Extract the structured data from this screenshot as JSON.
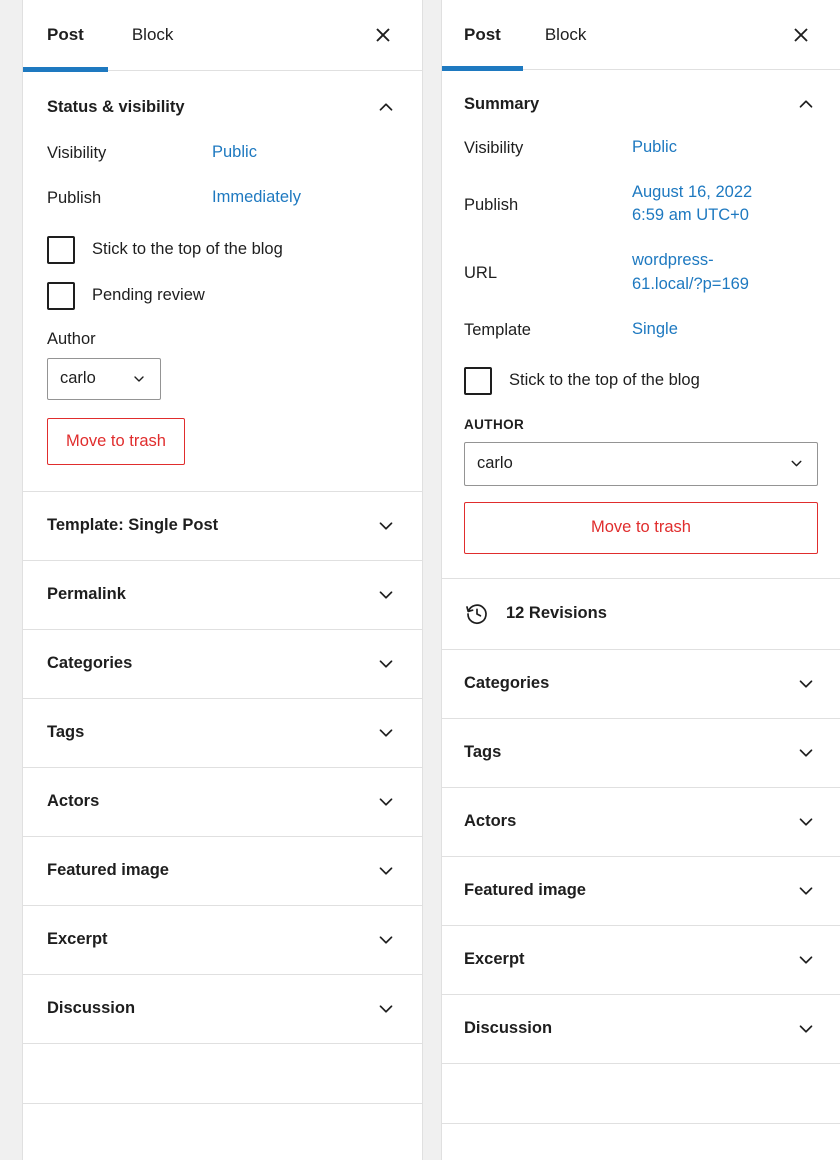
{
  "left_panel": {
    "tabs": [
      {
        "label": "Post",
        "active": true
      },
      {
        "label": "Block",
        "active": false
      }
    ],
    "close_icon": "close-icon",
    "status_section": {
      "title": "Status & visibility",
      "toggle_icon": "chevron-up-icon",
      "rows": [
        {
          "label": "Visibility",
          "value": "Public"
        },
        {
          "label": "Publish",
          "value": "Immediately"
        }
      ],
      "checkboxes": [
        {
          "label": "Stick to the top of the blog",
          "checked": false
        },
        {
          "label": "Pending review",
          "checked": false
        }
      ],
      "author_label": "Author",
      "author_value": "carlo",
      "trash_label": "Move to trash"
    },
    "sections": [
      {
        "title": "Template: Single Post",
        "toggle_icon": "chevron-down-icon"
      },
      {
        "title": "Permalink",
        "toggle_icon": "chevron-down-icon"
      },
      {
        "title": "Categories",
        "toggle_icon": "chevron-down-icon"
      },
      {
        "title": "Tags",
        "toggle_icon": "chevron-down-icon"
      },
      {
        "title": "Actors",
        "toggle_icon": "chevron-down-icon"
      },
      {
        "title": "Featured image",
        "toggle_icon": "chevron-down-icon"
      },
      {
        "title": "Excerpt",
        "toggle_icon": "chevron-down-icon"
      },
      {
        "title": "Discussion",
        "toggle_icon": "chevron-down-icon"
      }
    ]
  },
  "right_panel": {
    "tabs": [
      {
        "label": "Post",
        "active": true
      },
      {
        "label": "Block",
        "active": false
      }
    ],
    "close_icon": "close-icon",
    "summary_section": {
      "title": "Summary",
      "toggle_icon": "chevron-up-icon",
      "rows": [
        {
          "label": "Visibility",
          "value": "Public"
        },
        {
          "label": "Publish",
          "value": "August 16, 2022 6:59 am UTC+0"
        },
        {
          "label": "URL",
          "value": "wordpress-61.local/?p=169"
        },
        {
          "label": "Template",
          "value": "Single"
        }
      ],
      "checkboxes": [
        {
          "label": "Stick to the top of the blog",
          "checked": false
        }
      ],
      "author_label": "AUTHOR",
      "author_value": "carlo",
      "trash_label": "Move to trash"
    },
    "revisions": {
      "icon": "revisions-clock-icon",
      "label": "12 Revisions"
    },
    "sections": [
      {
        "title": "Categories",
        "toggle_icon": "chevron-down-icon"
      },
      {
        "title": "Tags",
        "toggle_icon": "chevron-down-icon"
      },
      {
        "title": "Actors",
        "toggle_icon": "chevron-down-icon"
      },
      {
        "title": "Featured image",
        "toggle_icon": "chevron-down-icon"
      },
      {
        "title": "Excerpt",
        "toggle_icon": "chevron-down-icon"
      },
      {
        "title": "Discussion",
        "toggle_icon": "chevron-down-icon"
      }
    ]
  },
  "colors": {
    "accent_blue": "#1e79c0",
    "destructive_red": "#e02d2d",
    "text": "#1e1e1e",
    "border": "#e0e0e0"
  }
}
